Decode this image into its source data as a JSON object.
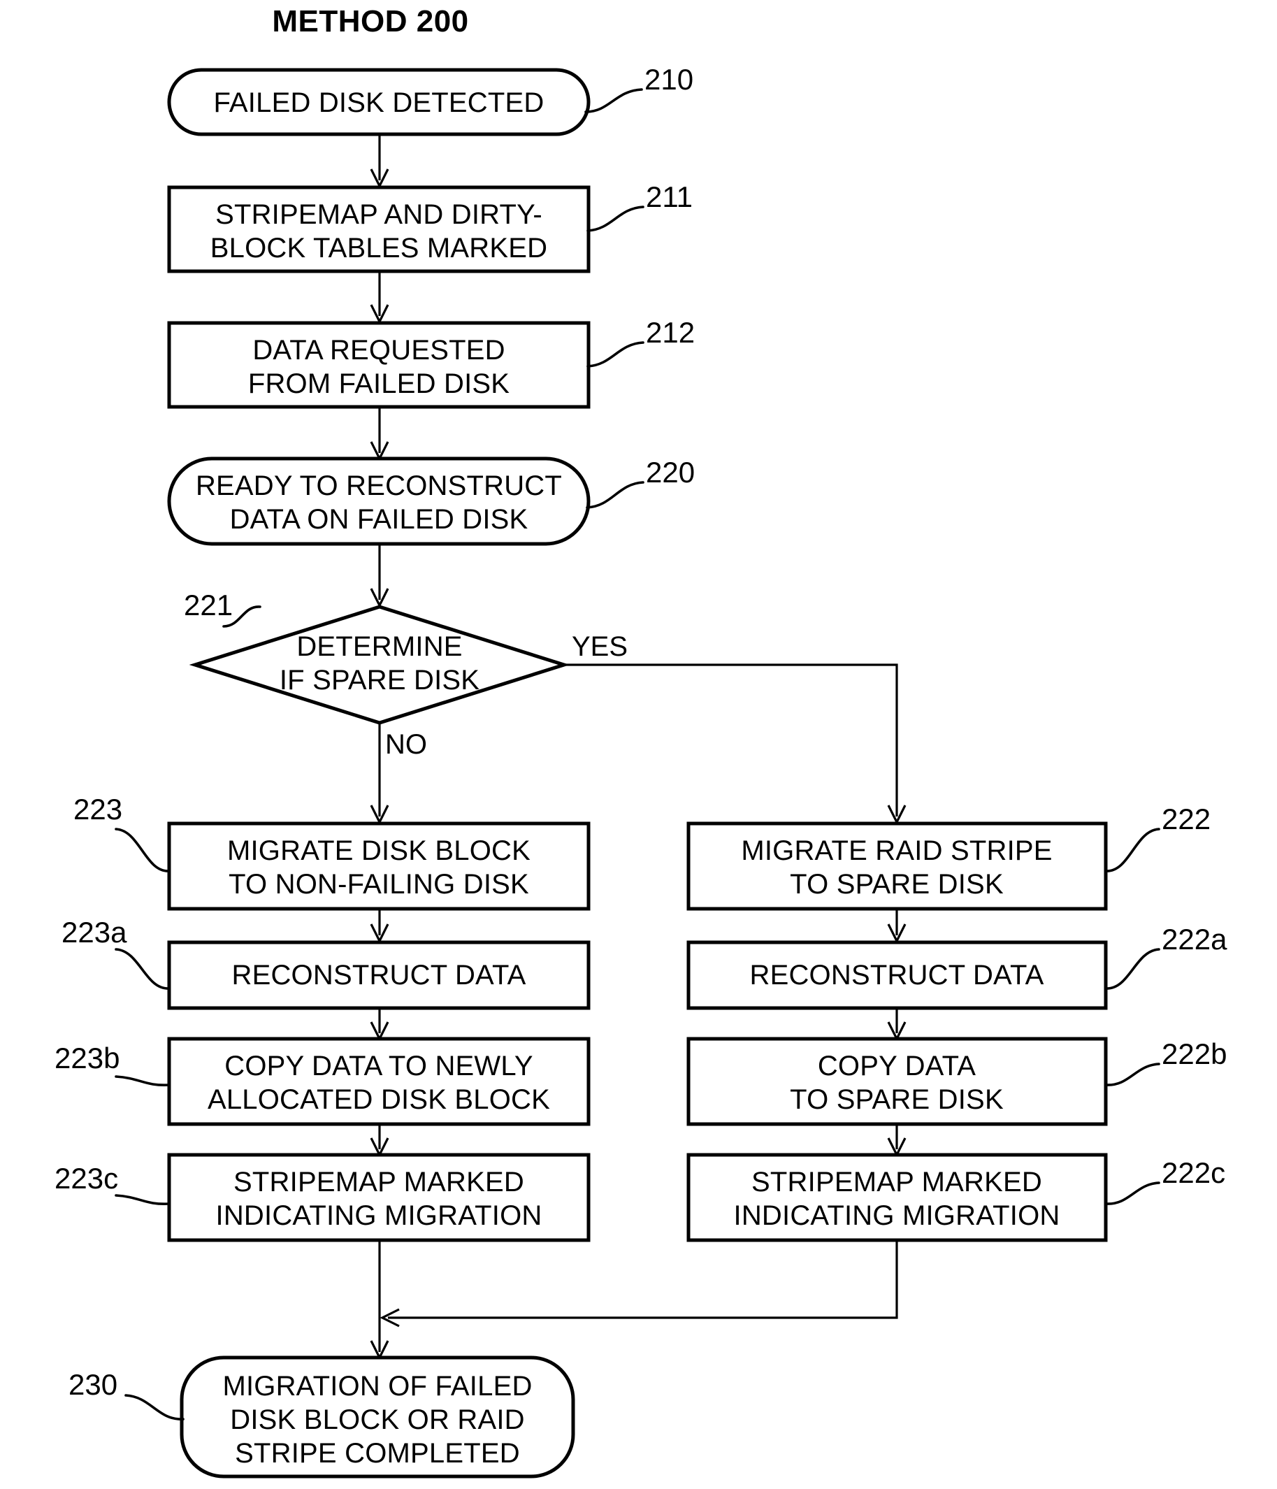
{
  "figure": {
    "title": "METHOD 200"
  },
  "nodes": [
    {
      "id": "n210",
      "ref": "210",
      "shape": "terminator",
      "lines": [
        "FAILED DISK DETECTED"
      ]
    },
    {
      "id": "n211",
      "ref": "211",
      "shape": "process",
      "lines": [
        "STRIPEMAP AND DIRTY-",
        "BLOCK TABLES MARKED"
      ]
    },
    {
      "id": "n212",
      "ref": "212",
      "shape": "process",
      "lines": [
        "DATA REQUESTED",
        "FROM FAILED DISK"
      ]
    },
    {
      "id": "n220",
      "ref": "220",
      "shape": "terminator",
      "lines": [
        "READY TO RECONSTRUCT",
        "DATA ON FAILED DISK"
      ]
    },
    {
      "id": "n221",
      "ref": "221",
      "shape": "decision",
      "lines": [
        "DETERMINE",
        "IF SPARE DISK"
      ]
    },
    {
      "id": "n223",
      "ref": "223",
      "shape": "process",
      "lines": [
        "MIGRATE DISK BLOCK",
        "TO NON-FAILING DISK"
      ]
    },
    {
      "id": "n222",
      "ref": "222",
      "shape": "process",
      "lines": [
        "MIGRATE RAID STRIPE",
        "TO SPARE DISK"
      ]
    },
    {
      "id": "n223a",
      "ref": "223a",
      "shape": "process",
      "lines": [
        "RECONSTRUCT DATA"
      ]
    },
    {
      "id": "n222a",
      "ref": "222a",
      "shape": "process",
      "lines": [
        "RECONSTRUCT DATA"
      ]
    },
    {
      "id": "n223b",
      "ref": "223b",
      "shape": "process",
      "lines": [
        "COPY DATA TO NEWLY",
        "ALLOCATED DISK BLOCK"
      ]
    },
    {
      "id": "n222b",
      "ref": "222b",
      "shape": "process",
      "lines": [
        "COPY DATA",
        "TO SPARE DISK"
      ]
    },
    {
      "id": "n223c",
      "ref": "223c",
      "shape": "process",
      "lines": [
        "STRIPEMAP MARKED",
        "INDICATING MIGRATION"
      ]
    },
    {
      "id": "n222c",
      "ref": "222c",
      "shape": "process",
      "lines": [
        "STRIPEMAP MARKED",
        "INDICATING MIGRATION"
      ]
    },
    {
      "id": "n230",
      "ref": "230",
      "shape": "terminator",
      "lines": [
        "MIGRATION OF FAILED",
        "DISK BLOCK OR RAID",
        "STRIPE COMPLETED"
      ]
    }
  ],
  "edge_labels": {
    "yes": "YES",
    "no": "NO"
  },
  "colors": {
    "stroke": "#000000",
    "fill": "#ffffff"
  }
}
